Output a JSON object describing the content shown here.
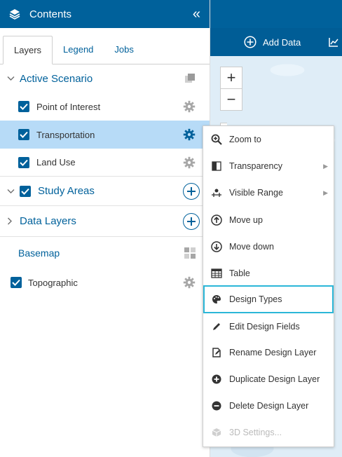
{
  "panel": {
    "title": "Contents",
    "collapse_glyph": "«",
    "tabs": [
      {
        "label": "Layers",
        "active": true
      },
      {
        "label": "Legend",
        "active": false
      },
      {
        "label": "Jobs",
        "active": false
      }
    ]
  },
  "layers": {
    "active_scenario": {
      "label": "Active Scenario",
      "expanded": true
    },
    "scenario_layers": [
      {
        "label": "Point of Interest",
        "checked": true,
        "selected": false
      },
      {
        "label": "Transportation",
        "checked": true,
        "selected": true
      },
      {
        "label": "Land Use",
        "checked": true,
        "selected": false
      }
    ],
    "study_areas": {
      "label": "Study Areas",
      "checked": true,
      "expanded": true
    },
    "data_layers": {
      "label": "Data Layers",
      "expanded": false
    },
    "basemap": {
      "label": "Basemap"
    },
    "basemap_layer": {
      "label": "Topographic",
      "checked": true
    }
  },
  "map": {
    "add_data_label": "Add Data",
    "zoom_in": "+",
    "zoom_out": "−"
  },
  "context_menu": {
    "items": [
      {
        "label": "Zoom to",
        "icon": "zoom-in-icon"
      },
      {
        "label": "Transparency",
        "icon": "transparency-icon",
        "submenu": true
      },
      {
        "label": "Visible Range",
        "icon": "visible-range-icon",
        "submenu": true
      },
      {
        "label": "Move up",
        "icon": "arrow-up-circle-icon"
      },
      {
        "label": "Move down",
        "icon": "arrow-down-circle-icon"
      },
      {
        "label": "Table",
        "icon": "table-icon"
      },
      {
        "label": "Design Types",
        "icon": "palette-icon",
        "highlighted": true
      },
      {
        "label": "Edit Design Fields",
        "icon": "pencil-icon"
      },
      {
        "label": "Rename Design Layer",
        "icon": "rename-icon"
      },
      {
        "label": "Duplicate Design Layer",
        "icon": "plus-circle-icon"
      },
      {
        "label": "Delete Design Layer",
        "icon": "minus-circle-icon"
      },
      {
        "label": "3D Settings...",
        "icon": "cube-icon",
        "disabled": true
      }
    ]
  },
  "colors": {
    "header_blue": "#00619b",
    "selected_row": "#b7dbf7",
    "highlight_border": "#2bb7d8"
  }
}
